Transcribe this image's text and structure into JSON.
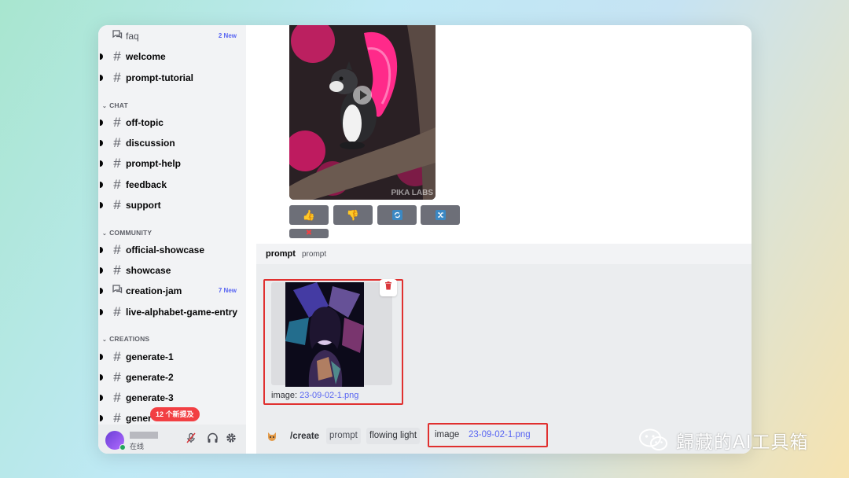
{
  "sidebar": {
    "channels": [
      {
        "name": "faq",
        "icon": "forum-icon",
        "badge": "2 New"
      },
      {
        "name": "welcome",
        "icon": "hash-icon"
      },
      {
        "name": "prompt-tutorial",
        "icon": "hash-icon"
      }
    ],
    "categories": [
      {
        "label": "CHAT",
        "channels": [
          {
            "name": "off-topic",
            "icon": "hash-icon"
          },
          {
            "name": "discussion",
            "icon": "hash-thread-icon"
          },
          {
            "name": "prompt-help",
            "icon": "hash-thread-icon"
          },
          {
            "name": "feedback",
            "icon": "hash-icon"
          },
          {
            "name": "support",
            "icon": "hash-icon"
          }
        ]
      },
      {
        "label": "COMMUNITY",
        "channels": [
          {
            "name": "official-showcase",
            "icon": "hash-icon"
          },
          {
            "name": "showcase",
            "icon": "hash-thread-icon"
          },
          {
            "name": "creation-jam",
            "icon": "forum-icon",
            "badge": "7 New"
          },
          {
            "name": "live-alphabet-game-entry",
            "icon": "hash-icon"
          }
        ]
      },
      {
        "label": "CREATIONS",
        "channels": [
          {
            "name": "generate-1",
            "icon": "hash-thread-icon"
          },
          {
            "name": "generate-2",
            "icon": "hash-thread-icon"
          },
          {
            "name": "generate-3",
            "icon": "hash-icon"
          },
          {
            "name": "gener",
            "icon": "hash-thread-icon"
          }
        ]
      }
    ],
    "mentions_badge": "12 个新提及",
    "user": {
      "status": "在线"
    }
  },
  "message": {
    "video_watermark": "PIKA LABS",
    "action_buttons": [
      "thumbs-up-icon",
      "thumbs-down-icon",
      "refresh-icon",
      "shuffle-icon"
    ],
    "delete_button": "x-icon"
  },
  "command": {
    "name": "prompt",
    "description": "prompt",
    "attachment": {
      "label": "image:",
      "filename": "23-09-02-1.png"
    },
    "slash": "/create",
    "options": [
      {
        "key": "prompt",
        "value": "flowing light"
      },
      {
        "key": "image",
        "value": "23-09-02-1.png"
      }
    ]
  },
  "watermark": {
    "text": "歸藏的AI工具箱"
  },
  "colors": {
    "accent": "#5865f2",
    "highlight_border": "#e0302f",
    "danger": "#da373c"
  }
}
